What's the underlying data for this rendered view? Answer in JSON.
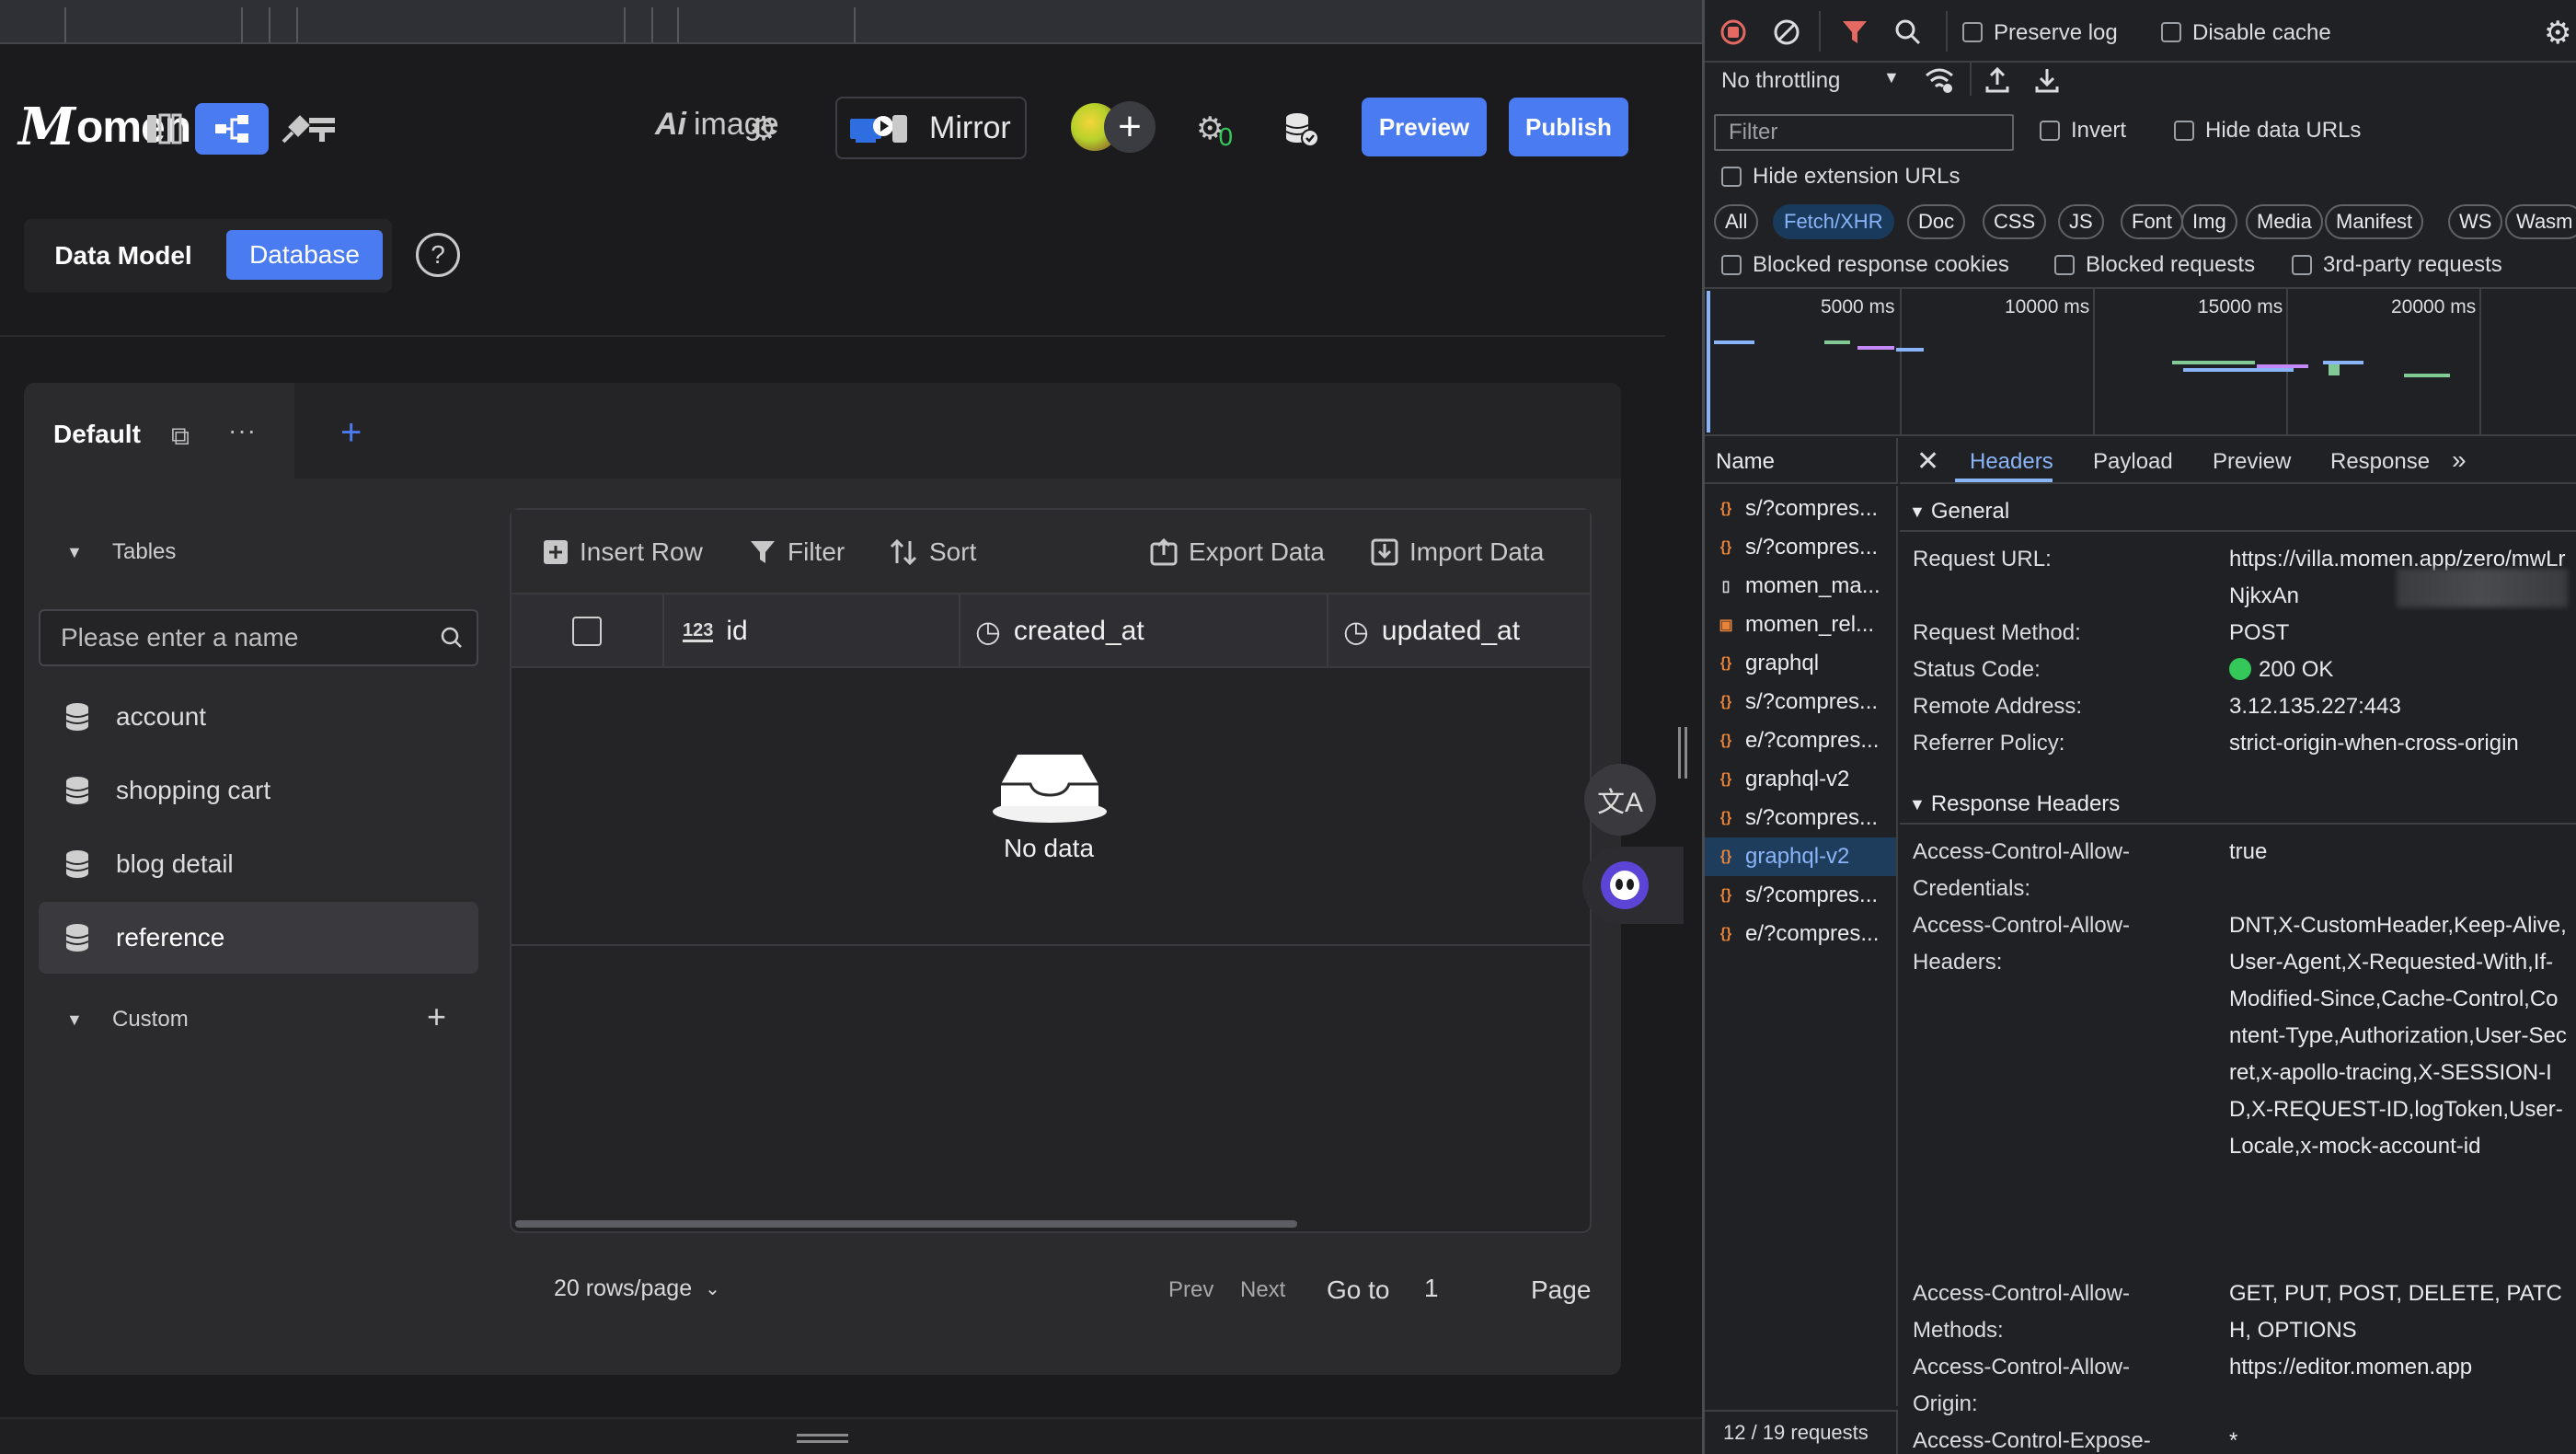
{
  "app": {
    "brand": {
      "initial": "M",
      "rest": "omen"
    },
    "toolbar": {
      "ai_prefix": "Ai",
      "ai_label": "image",
      "mirror_label": "Mirror",
      "avatar_badge": "+",
      "plugin_count": "0",
      "preview_label": "Preview",
      "publish_label": "Publish"
    },
    "mode_tabs": {
      "data_model": "Data Model",
      "database": "Database",
      "help": "?"
    },
    "db_tab": {
      "label": "Default",
      "more": "···",
      "add": "+"
    },
    "sidebar": {
      "tables_label": "Tables",
      "search_placeholder": "Please enter a name",
      "tables": [
        "account",
        "shopping cart",
        "blog detail",
        "reference"
      ],
      "selected_table": "reference",
      "custom_label": "Custom",
      "custom_add": "+"
    },
    "grid": {
      "toolbar": {
        "insert_row": "Insert Row",
        "filter": "Filter",
        "sort": "Sort",
        "export": "Export Data",
        "import": "Import Data"
      },
      "columns": [
        {
          "type_badge": "123",
          "name": "id"
        },
        {
          "type_badge": "◷",
          "name": "created_at"
        },
        {
          "type_badge": "◷",
          "name": "updated_at"
        }
      ],
      "empty_text": "No data"
    },
    "pagination": {
      "rows_per_page": "20 rows/page",
      "prev": "Prev",
      "next": "Next",
      "goto": "Go to",
      "page_value": "1",
      "page_label": "Page"
    },
    "floating": {
      "translate_icon": "文A"
    },
    "colors": {
      "accent": "#4b7bf0",
      "bg": "#1b1b1d",
      "panel": "#2b2b2e"
    }
  },
  "devtools": {
    "toolbar": {
      "preserve_log": "Preserve log",
      "disable_cache": "Disable cache",
      "throttling": "No throttling"
    },
    "filter": {
      "placeholder": "Filter",
      "invert": "Invert",
      "hide_data_urls": "Hide data URLs",
      "hide_extension_urls": "Hide extension URLs"
    },
    "type_chips": [
      "All",
      "Fetch/XHR",
      "Doc",
      "CSS",
      "JS",
      "Font",
      "Img",
      "Media",
      "Manifest",
      "WS",
      "Wasm"
    ],
    "active_chip": "Fetch/XHR",
    "blocked": {
      "cookies": "Blocked response cookies",
      "requests": "Blocked requests",
      "third_party": "3rd-party requests"
    },
    "overview_ticks": [
      "5000 ms",
      "10000 ms",
      "15000 ms",
      "20000 ms"
    ],
    "name_header": "Name",
    "detail_tabs": [
      "Headers",
      "Payload",
      "Preview",
      "Response"
    ],
    "active_detail_tab": "Headers",
    "requests": [
      {
        "name": "s/?compres...",
        "kind": "xhr"
      },
      {
        "name": "s/?compres...",
        "kind": "xhr"
      },
      {
        "name": "momen_ma...",
        "kind": "doc"
      },
      {
        "name": "momen_rel...",
        "kind": "js"
      },
      {
        "name": "graphql",
        "kind": "xhr"
      },
      {
        "name": "s/?compres...",
        "kind": "xhr"
      },
      {
        "name": "e/?compres...",
        "kind": "xhr"
      },
      {
        "name": "graphql-v2",
        "kind": "xhr"
      },
      {
        "name": "s/?compres...",
        "kind": "xhr"
      },
      {
        "name": "graphql-v2",
        "kind": "xhr"
      },
      {
        "name": "s/?compres...",
        "kind": "xhr"
      },
      {
        "name": "e/?compres...",
        "kind": "xhr"
      }
    ],
    "selected_request_index": 9,
    "request_count": "12 / 19 requests",
    "general": {
      "title": "General",
      "request_url_key": "Request URL:",
      "request_url": "https://villa.momen.app/zero/mwLrNjkxAn",
      "request_method_key": "Request Method:",
      "request_method": "POST",
      "status_code_key": "Status Code:",
      "status_code": "200 OK",
      "remote_address_key": "Remote Address:",
      "remote_address": "3.12.135.227:443",
      "referrer_policy_key": "Referrer Policy:",
      "referrer_policy": "strict-origin-when-cross-origin"
    },
    "response_headers": {
      "title": "Response Headers",
      "items": [
        {
          "key": "Access-Control-Allow-Credentials:",
          "value": "true"
        },
        {
          "key": "Access-Control-Allow-Headers:",
          "value": "DNT,X-CustomHeader,Keep-Alive,User-Agent,X-Requested-With,If-Modified-Since,Cache-Control,Content-Type,Authorization,User-Secret,x-apollo-tracing,X-SESSION-ID,X-REQUEST-ID,logToken,User-Locale,x-mock-account-id"
        },
        {
          "key": "Access-Control-Allow-Methods:",
          "value": "GET, PUT, POST, DELETE, PATCH, OPTIONS"
        },
        {
          "key": "Access-Control-Allow-Origin:",
          "value": "https://editor.momen.app"
        },
        {
          "key": "Access-Control-Expose-",
          "value": "*"
        }
      ]
    },
    "colors": {
      "active_blue": "#8ab4f8",
      "status_green": "#34c759",
      "record_red": "#e46962"
    }
  }
}
